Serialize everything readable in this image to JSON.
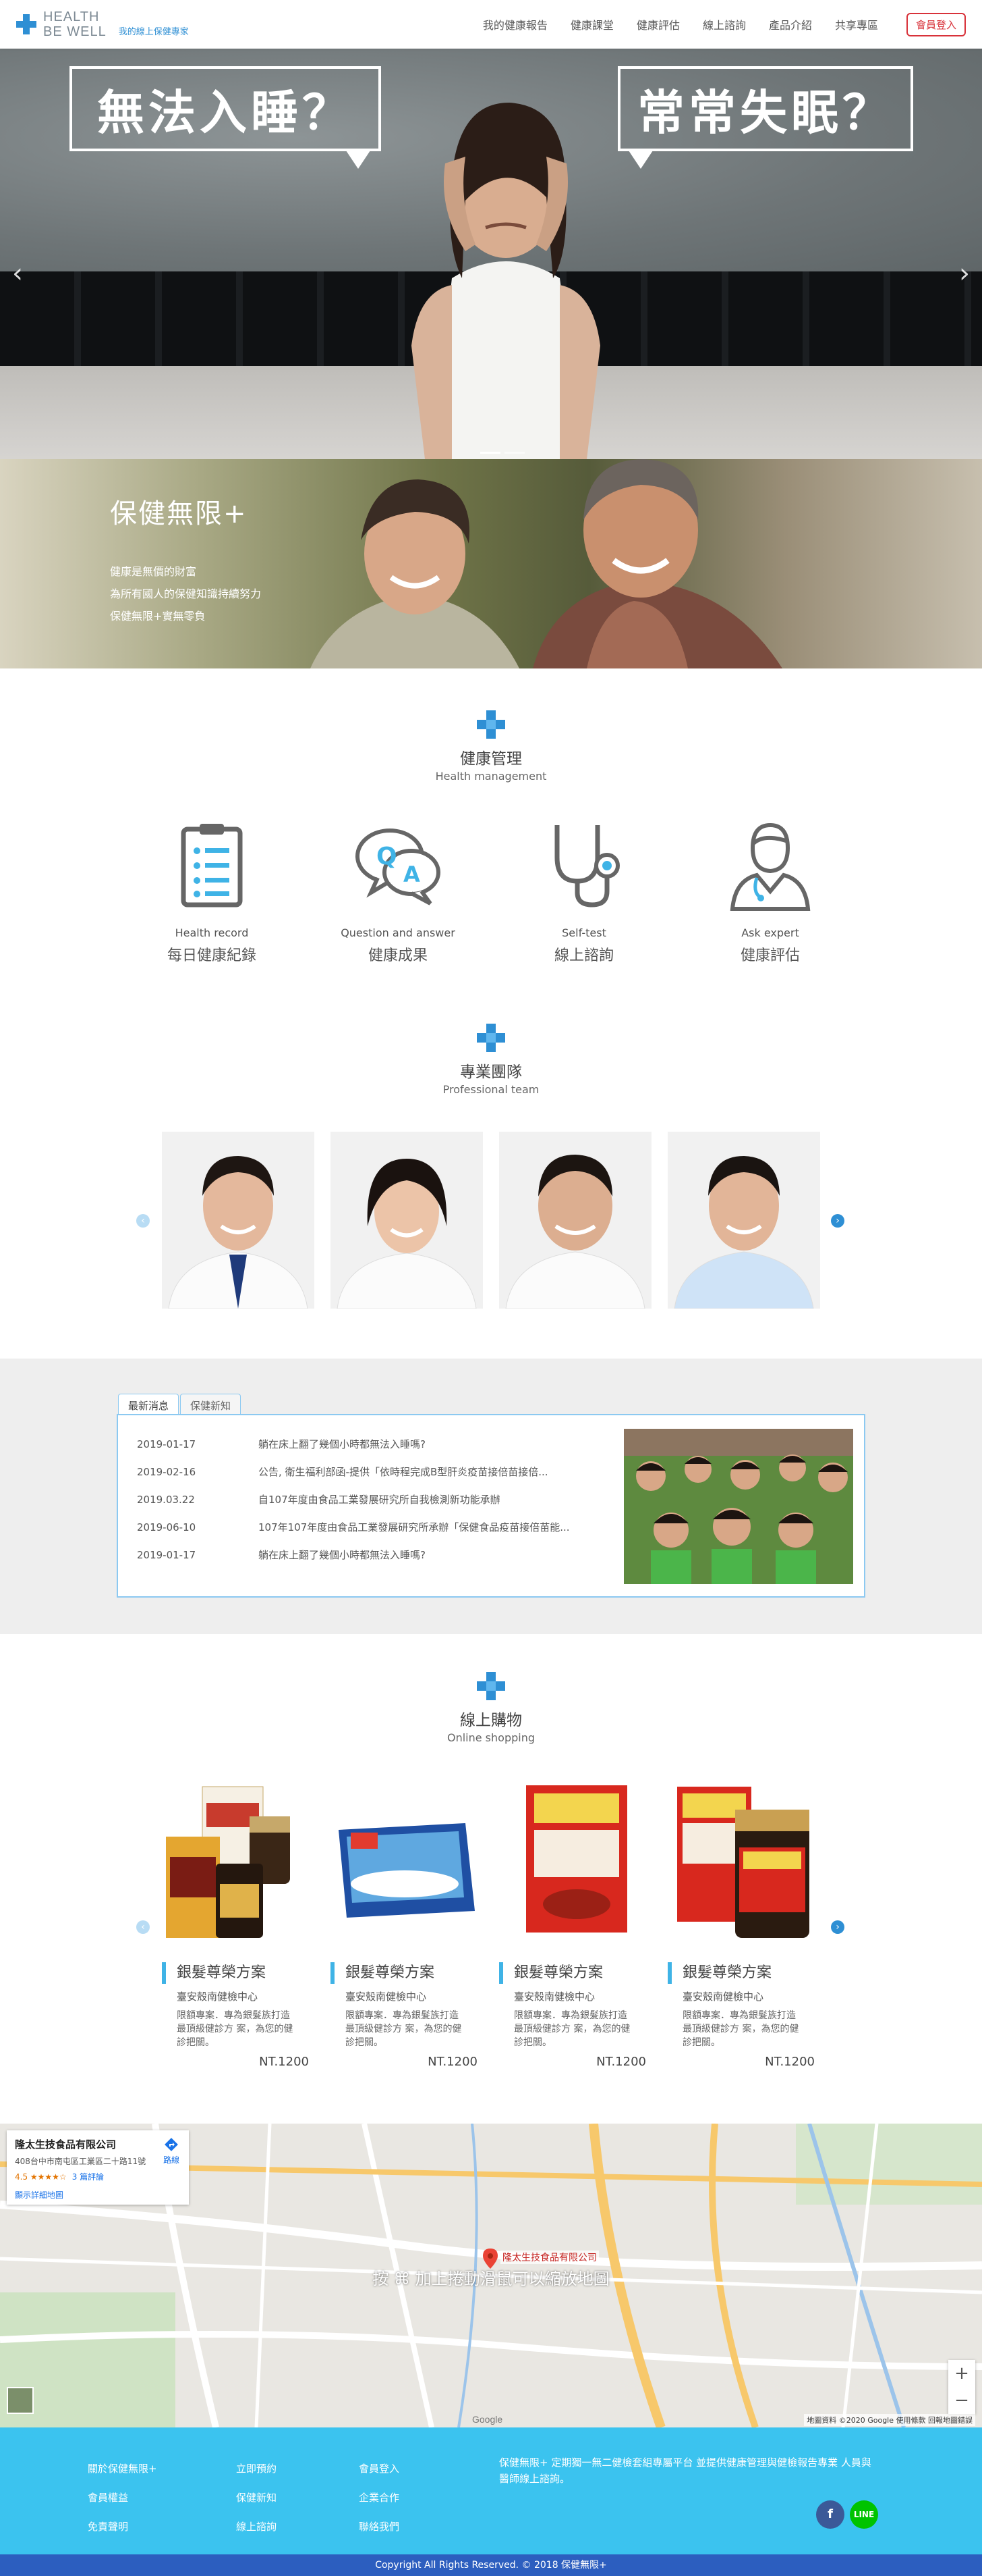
{
  "header": {
    "logo_line1": "HEALTH",
    "logo_line2": "BE WELL",
    "logo_tagline": "我的線上保健專家",
    "nav": [
      "我的健康報告",
      "健康課堂",
      "健康評估",
      "線上諮詢",
      "產品介紹",
      "共享專區"
    ],
    "login_label": "會員登入"
  },
  "hero": {
    "bubble_left": "無法入睡？",
    "bubble_right": "常常失眠？",
    "prev_arrow": "‹",
    "next_arrow": "›"
  },
  "banner": {
    "title": "保健無限+",
    "lines": [
      "健康是無價的財富",
      "為所有國人的保健知識持續努力",
      "保健無限+實無零負"
    ]
  },
  "health_section": {
    "title": "健康管理",
    "subtitle": "Health management",
    "items": [
      {
        "en": "Health record",
        "zh": "每日健康紀錄",
        "icon": "clipboard-icon"
      },
      {
        "en": "Question and answer",
        "zh": "健康成果",
        "icon": "qa-icon"
      },
      {
        "en": "Self-test",
        "zh": "線上諮詢",
        "icon": "stethoscope-icon"
      },
      {
        "en": "Ask expert",
        "zh": "健康評估",
        "icon": "doctor-icon"
      }
    ]
  },
  "team_section": {
    "title": "專業團隊",
    "subtitle": "Professional team",
    "members": [
      "doctor-photo-1",
      "doctor-photo-2",
      "doctor-photo-3",
      "doctor-photo-4"
    ],
    "prev": "‹",
    "next": "›"
  },
  "news": {
    "tabs": [
      "最新消息",
      "保健新知"
    ],
    "rows": [
      {
        "date": "2019-01-17",
        "title": "躺在床上翻了幾個小時都無法入睡嗎?"
      },
      {
        "date": "2019-02-16",
        "title": "公告, 衛生福利部函-提供「依時程完成B型肝炎疫苗接倍苗接倍..."
      },
      {
        "date": "2019.03.22",
        "title": "自107年度由食品工業發展研究所自我檢測新功能承辦"
      },
      {
        "date": "2019-06-10",
        "title": "107年107年度由食品工業發展研究所承辦「保健食品疫苗接倍苗能..."
      },
      {
        "date": "2019-01-17",
        "title": "躺在床上翻了幾個小時都無法入睡嗎?"
      }
    ]
  },
  "shop_section": {
    "title": "線上購物",
    "subtitle": "Online shopping",
    "products": [
      {
        "title": "銀髮尊榮方案",
        "sub": "臺安殼南健檢中心",
        "desc": "限額專案．專為銀髮族打造最頂級健診方 案，為您的健診把關。",
        "price": "NT.1200"
      },
      {
        "title": "銀髮尊榮方案",
        "sub": "臺安殼南健檢中心",
        "desc": "限額專案．專為銀髮族打造最頂級健診方 案，為您的健診把關。",
        "price": "NT.1200"
      },
      {
        "title": "銀髮尊榮方案",
        "sub": "臺安殼南健檢中心",
        "desc": "限額專案．專為銀髮族打造最頂級健診方 案，為您的健診把關。",
        "price": "NT.1200"
      },
      {
        "title": "銀髮尊榮方案",
        "sub": "臺安殼南健檢中心",
        "desc": "限額專案．專為銀髮族打造最頂級健診方 案，為您的健診把關。",
        "price": "NT.1200"
      }
    ],
    "prev": "‹",
    "next": "›"
  },
  "map": {
    "company": "隆太生技食品有限公司",
    "address": "408台中市南屯區工業區二十路11號",
    "rating": "4.5 ★★★★☆",
    "reviews": "3 篇評論",
    "larger_map": "顯示詳細地圖",
    "directions": "路線",
    "hint": "按 ⌘ 加上捲動滑鼠可以縮放地圖",
    "pin_label": "隆太生技食品有限公司",
    "footer": "地圖資料 ©2020 Google   使用條款   回報地圖錯誤",
    "google": "Google",
    "zoom_in": "+",
    "zoom_out": "−"
  },
  "footer": {
    "col1": [
      "關於保健無限+",
      "會員權益",
      "免責聲明"
    ],
    "col2": [
      "立即預約",
      "保健新知",
      "線上諮詢"
    ],
    "col3": [
      "會員登入",
      "企業合作",
      "聯絡我們"
    ],
    "description": "保健無限+ 定期獨一無二健檢套組專屬平台 並提供健康管理與健檢報告專業 人員與醫師線上諮詢。",
    "facebook": "f",
    "line": "LINE",
    "copyright": "Copyright All Rights Reserved. © 2018 保健無限+"
  }
}
